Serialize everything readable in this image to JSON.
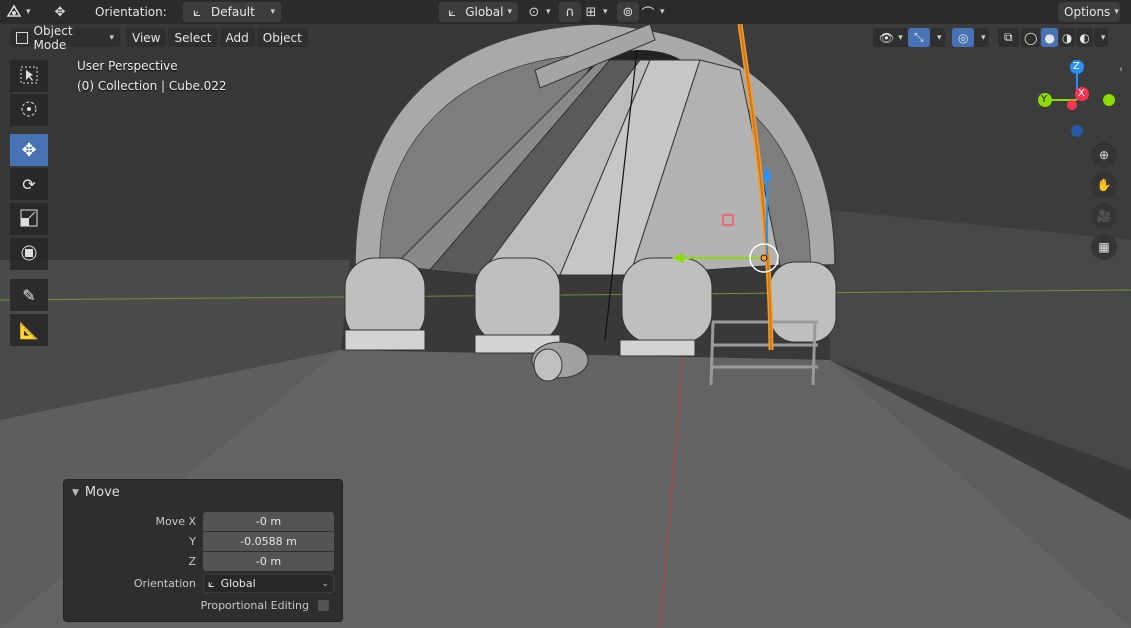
{
  "top_header": {
    "orientation_label": "Orientation:",
    "orientation_value": "Default",
    "transform_orientation": "Global",
    "options_label": "Options"
  },
  "viewport_header": {
    "mode": "Object Mode",
    "menus": [
      "View",
      "Select",
      "Add",
      "Object"
    ]
  },
  "overlay": {
    "perspective": "User Perspective",
    "collection": "(0) Collection | Cube.022"
  },
  "gizmo": {
    "z": "Z",
    "y": "Y",
    "x": "X"
  },
  "move_panel": {
    "title": "Move",
    "move_x_label": "Move X",
    "move_x_value": "-0 m",
    "y_label": "Y",
    "y_value": "-0.0588 m",
    "z_label": "Z",
    "z_value": "-0 m",
    "orientation_label": "Orientation",
    "orientation_value": "Global",
    "proportional_label": "Proportional Editing"
  },
  "icons": {
    "tools": [
      "select-box",
      "cursor",
      "move",
      "rotate",
      "scale",
      "transform",
      "annotate",
      "measure"
    ],
    "nav": [
      "zoom",
      "pan",
      "camera",
      "ortho-grid"
    ]
  },
  "colors": {
    "accent": "#4772b3",
    "x_axis": "#ff3352",
    "y_axis": "#8bdc00",
    "z_axis": "#2890ff",
    "selection_outline": "#f59b2a"
  }
}
